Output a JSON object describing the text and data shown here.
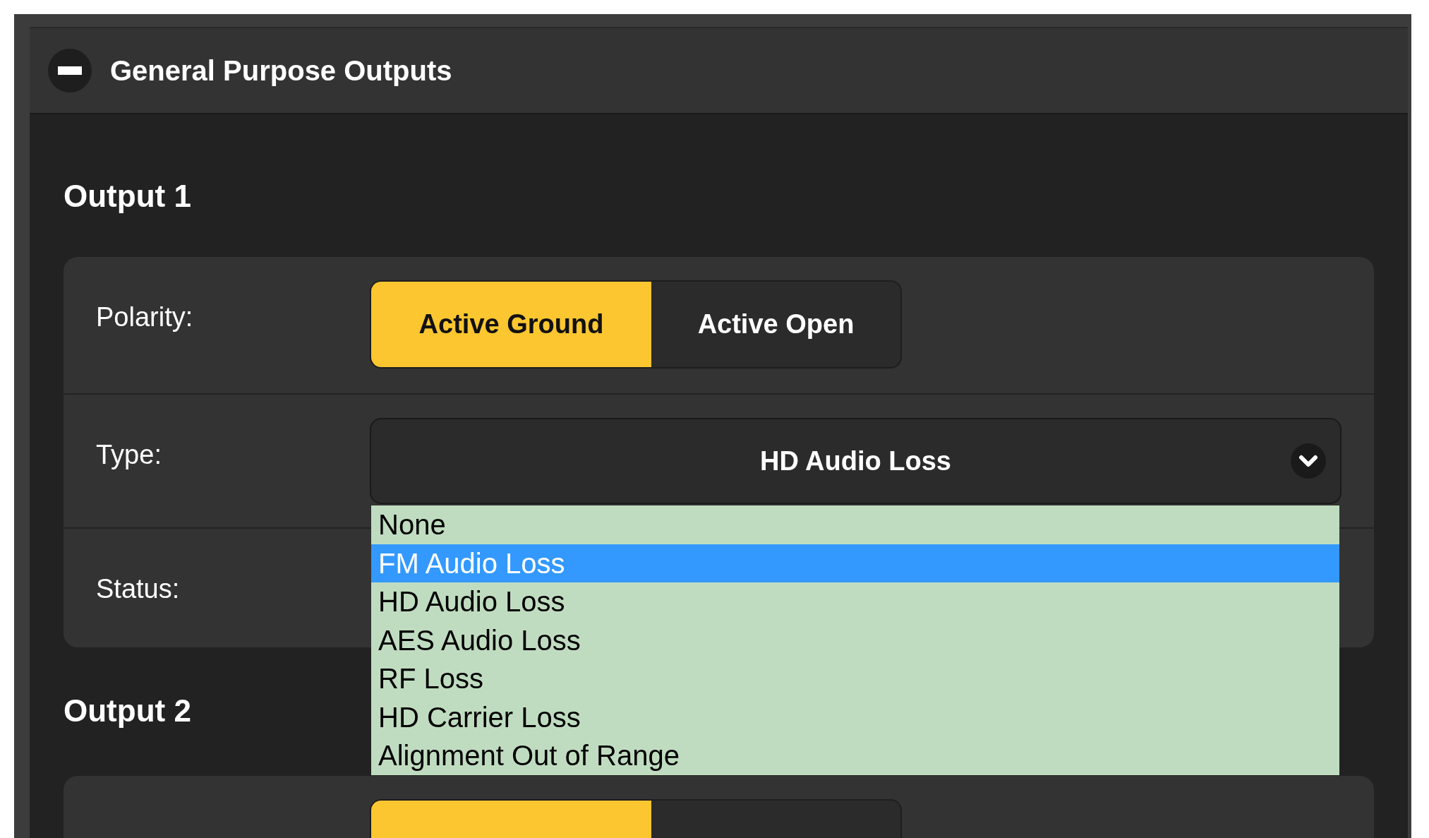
{
  "panel": {
    "title": "General Purpose Outputs",
    "expanded": true
  },
  "outputs": [
    {
      "title": "Output 1",
      "rows": [
        {
          "kind": "segmented",
          "label": "Polarity:",
          "options": [
            {
              "label": "Active Ground",
              "selected": true
            },
            {
              "label": "Active Open",
              "selected": false
            }
          ]
        },
        {
          "kind": "select",
          "label": "Type:",
          "value": "HD Audio Loss",
          "open": true,
          "options": [
            {
              "label": "None",
              "highlighted": false
            },
            {
              "label": "FM Audio Loss",
              "highlighted": true
            },
            {
              "label": "HD Audio Loss",
              "highlighted": false
            },
            {
              "label": "AES Audio Loss",
              "highlighted": false
            },
            {
              "label": "RF Loss",
              "highlighted": false
            },
            {
              "label": "HD Carrier Loss",
              "highlighted": false
            },
            {
              "label": "Alignment Out of Range",
              "highlighted": false
            }
          ]
        },
        {
          "kind": "empty",
          "label": "Status:"
        }
      ]
    },
    {
      "title": "Output 2",
      "rows": [
        {
          "kind": "segmented",
          "options": [
            {
              "selected": true
            },
            {
              "selected": false
            }
          ]
        }
      ]
    }
  ]
}
